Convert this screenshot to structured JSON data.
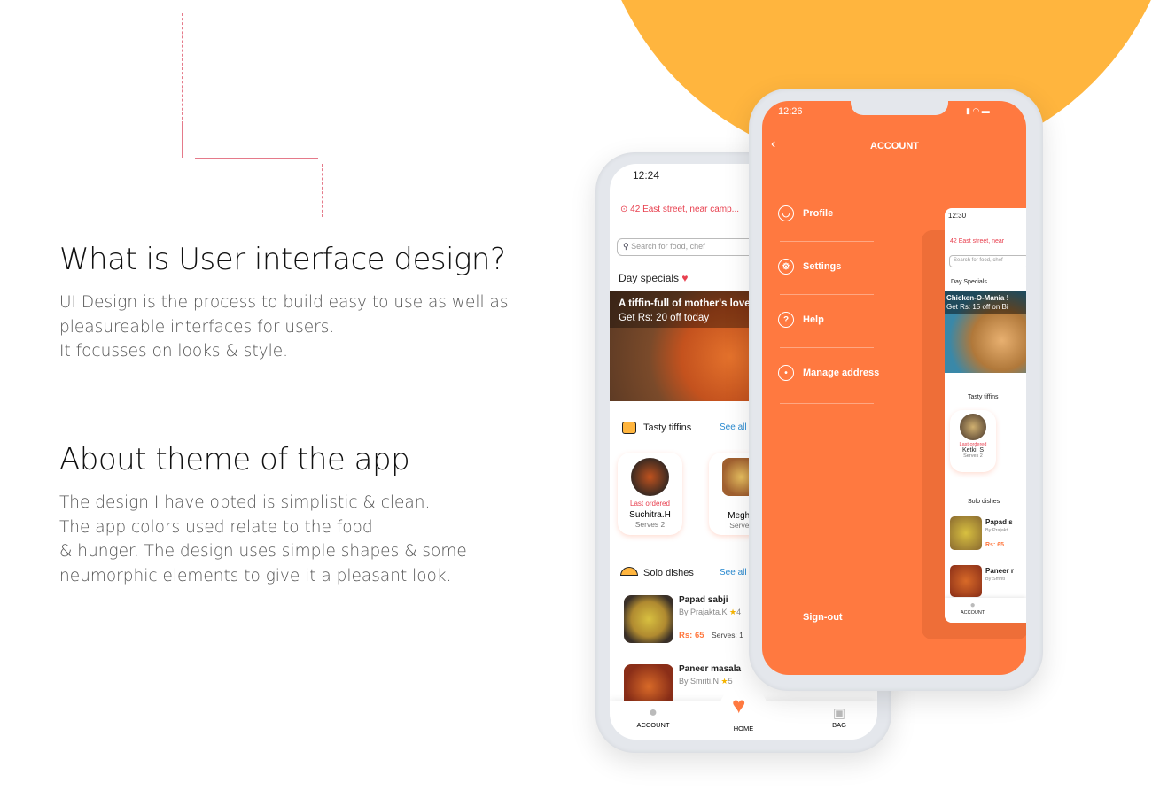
{
  "sections": [
    {
      "title": "What is User interface design?",
      "body": "UI Design is the process to build easy to use as well as\npleasureable interfaces for users.\nIt focusses on looks & style."
    },
    {
      "title": "About theme of the app",
      "body": "The design I have opted is simplistic  & clean.\nThe app colors used relate to the food\n& hunger. The design uses simple shapes & some\nneumorphic elements to give it a pleasant look."
    }
  ],
  "colors": {
    "accent": "#FF7940",
    "circle": "#FFB53E",
    "red": "#e8404f"
  },
  "home_phone": {
    "time": "12:24",
    "address": "42 East street, near camp...",
    "search_placeholder": "Search for food, chef",
    "day_specials": "Day specials",
    "banner_title": "A tiffin-full of mother's love",
    "banner_sub": "Get Rs: 20 off today",
    "tiffins_title": "Tasty tiffins",
    "see_all": "See all",
    "tiffins": [
      {
        "badge": "Last ordered",
        "name": "Suchitra.H",
        "serves": "Serves 2"
      },
      {
        "name": "Megha",
        "serves": "Serves"
      }
    ],
    "solo_title": "Solo dishes",
    "dishes": [
      {
        "name": "Papad sabji",
        "by": "By Prajakta.K",
        "rating": "4",
        "price": "Rs: 65",
        "serves": "Serves: 1"
      },
      {
        "name": "Paneer masala",
        "by": "By Smriti.N",
        "rating": "5"
      }
    ],
    "nav": {
      "account": "ACCOUNT",
      "home": "HOME",
      "bag": "BAG"
    }
  },
  "account_phone": {
    "time": "12:26",
    "title": "ACCOUNT",
    "menu": [
      {
        "label": "Profile",
        "icon": "user-icon"
      },
      {
        "label": "Settings",
        "icon": "gear-icon"
      },
      {
        "label": "Help",
        "icon": "help-icon"
      },
      {
        "label": "Manage address",
        "icon": "location-icon"
      }
    ],
    "signout": "Sign-out",
    "preview": {
      "time": "12:30",
      "address": "42 East street, near",
      "search_placeholder": "Search for food, chef",
      "day_specials": "Day Specials",
      "banner_title": "Chicken-O-Mania !",
      "banner_sub": "Get Rs: 15 off on Bi",
      "tiffins_title": "Tasty tiffins",
      "tiffin": {
        "badge": "Last ordered",
        "name": "Ketki. S",
        "serves": "Serves 2"
      },
      "solo_title": "Solo dishes",
      "dishes": [
        {
          "name": "Papad s",
          "by": "By Prajakt",
          "price": "Rs: 65"
        },
        {
          "name": "Paneer r",
          "by": "By Smriti"
        }
      ],
      "nav_account": "ACCOUNT"
    }
  }
}
